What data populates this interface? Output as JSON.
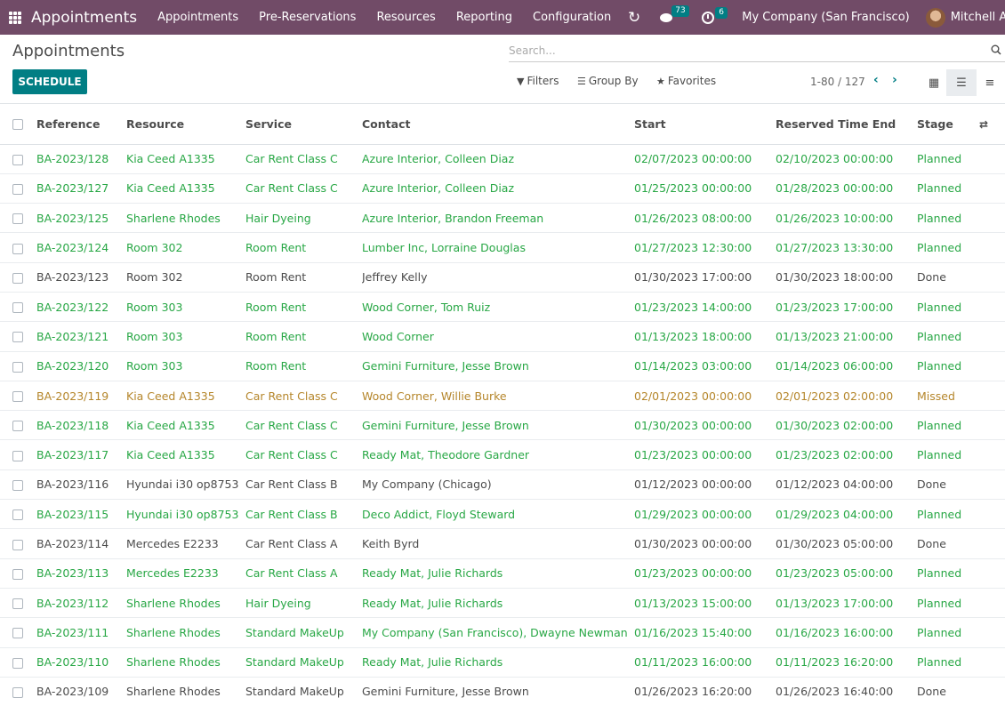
{
  "navbar": {
    "brand": "Appointments",
    "menu": [
      "Appointments",
      "Pre-Reservations",
      "Resources",
      "Reporting",
      "Configuration"
    ],
    "chat_count": "73",
    "activity_count": "6",
    "company": "My Company (San Francisco)",
    "user": "Mitchell Admin"
  },
  "page": {
    "title": "Appointments",
    "search_placeholder": "Search...",
    "schedule_label": "SCHEDULE",
    "filters_label": "Filters",
    "groupby_label": "Group By",
    "favorites_label": "Favorites",
    "pager": "1-80 / 127"
  },
  "colors": {
    "navbar": "#714b67",
    "accent": "#017e84",
    "planned": "#28a745",
    "missed": "#b5862b",
    "done": "#4c4c4c"
  },
  "table": {
    "headers": [
      "Reference",
      "Resource",
      "Service",
      "Contact",
      "Start",
      "Reserved Time End",
      "Stage"
    ],
    "rows": [
      {
        "ref": "BA-2023/128",
        "resource": "Kia Ceed A1335",
        "service": "Car Rent Class C",
        "contact": "Azure Interior, Colleen Diaz",
        "start": "02/07/2023 00:00:00",
        "end": "02/10/2023 00:00:00",
        "stage": "Planned"
      },
      {
        "ref": "BA-2023/127",
        "resource": "Kia Ceed A1335",
        "service": "Car Rent Class C",
        "contact": "Azure Interior, Colleen Diaz",
        "start": "01/25/2023 00:00:00",
        "end": "01/28/2023 00:00:00",
        "stage": "Planned"
      },
      {
        "ref": "BA-2023/125",
        "resource": "Sharlene Rhodes",
        "service": "Hair Dyeing",
        "contact": "Azure Interior, Brandon Freeman",
        "start": "01/26/2023 08:00:00",
        "end": "01/26/2023 10:00:00",
        "stage": "Planned"
      },
      {
        "ref": "BA-2023/124",
        "resource": "Room 302",
        "service": "Room Rent",
        "contact": "Lumber Inc, Lorraine Douglas",
        "start": "01/27/2023 12:30:00",
        "end": "01/27/2023 13:30:00",
        "stage": "Planned"
      },
      {
        "ref": "BA-2023/123",
        "resource": "Room 302",
        "service": "Room Rent",
        "contact": "Jeffrey Kelly",
        "start": "01/30/2023 17:00:00",
        "end": "01/30/2023 18:00:00",
        "stage": "Done"
      },
      {
        "ref": "BA-2023/122",
        "resource": "Room 303",
        "service": "Room Rent",
        "contact": "Wood Corner, Tom Ruiz",
        "start": "01/23/2023 14:00:00",
        "end": "01/23/2023 17:00:00",
        "stage": "Planned"
      },
      {
        "ref": "BA-2023/121",
        "resource": "Room 303",
        "service": "Room Rent",
        "contact": "Wood Corner",
        "start": "01/13/2023 18:00:00",
        "end": "01/13/2023 21:00:00",
        "stage": "Planned"
      },
      {
        "ref": "BA-2023/120",
        "resource": "Room 303",
        "service": "Room Rent",
        "contact": "Gemini Furniture, Jesse Brown",
        "start": "01/14/2023 03:00:00",
        "end": "01/14/2023 06:00:00",
        "stage": "Planned"
      },
      {
        "ref": "BA-2023/119",
        "resource": "Kia Ceed A1335",
        "service": "Car Rent Class C",
        "contact": "Wood Corner, Willie Burke",
        "start": "02/01/2023 00:00:00",
        "end": "02/01/2023 02:00:00",
        "stage": "Missed"
      },
      {
        "ref": "BA-2023/118",
        "resource": "Kia Ceed A1335",
        "service": "Car Rent Class C",
        "contact": "Gemini Furniture, Jesse Brown",
        "start": "01/30/2023 00:00:00",
        "end": "01/30/2023 02:00:00",
        "stage": "Planned"
      },
      {
        "ref": "BA-2023/117",
        "resource": "Kia Ceed A1335",
        "service": "Car Rent Class C",
        "contact": "Ready Mat, Theodore Gardner",
        "start": "01/23/2023 00:00:00",
        "end": "01/23/2023 02:00:00",
        "stage": "Planned"
      },
      {
        "ref": "BA-2023/116",
        "resource": "Hyundai i30 op8753",
        "service": "Car Rent Class B",
        "contact": "My Company (Chicago)",
        "start": "01/12/2023 00:00:00",
        "end": "01/12/2023 04:00:00",
        "stage": "Done"
      },
      {
        "ref": "BA-2023/115",
        "resource": "Hyundai i30 op8753",
        "service": "Car Rent Class B",
        "contact": "Deco Addict, Floyd Steward",
        "start": "01/29/2023 00:00:00",
        "end": "01/29/2023 04:00:00",
        "stage": "Planned"
      },
      {
        "ref": "BA-2023/114",
        "resource": "Mercedes E2233",
        "service": "Car Rent Class A",
        "contact": "Keith Byrd",
        "start": "01/30/2023 00:00:00",
        "end": "01/30/2023 05:00:00",
        "stage": "Done"
      },
      {
        "ref": "BA-2023/113",
        "resource": "Mercedes E2233",
        "service": "Car Rent Class A",
        "contact": "Ready Mat, Julie Richards",
        "start": "01/23/2023 00:00:00",
        "end": "01/23/2023 05:00:00",
        "stage": "Planned"
      },
      {
        "ref": "BA-2023/112",
        "resource": "Sharlene Rhodes",
        "service": "Hair Dyeing",
        "contact": "Ready Mat, Julie Richards",
        "start": "01/13/2023 15:00:00",
        "end": "01/13/2023 17:00:00",
        "stage": "Planned"
      },
      {
        "ref": "BA-2023/111",
        "resource": "Sharlene Rhodes",
        "service": "Standard MakeUp",
        "contact": "My Company (San Francisco), Dwayne Newman",
        "start": "01/16/2023 15:40:00",
        "end": "01/16/2023 16:00:00",
        "stage": "Planned"
      },
      {
        "ref": "BA-2023/110",
        "resource": "Sharlene Rhodes",
        "service": "Standard MakeUp",
        "contact": "Ready Mat, Julie Richards",
        "start": "01/11/2023 16:00:00",
        "end": "01/11/2023 16:20:00",
        "stage": "Planned"
      },
      {
        "ref": "BA-2023/109",
        "resource": "Sharlene Rhodes",
        "service": "Standard MakeUp",
        "contact": "Gemini Furniture, Jesse Brown",
        "start": "01/26/2023 16:20:00",
        "end": "01/26/2023 16:40:00",
        "stage": "Done"
      }
    ]
  }
}
